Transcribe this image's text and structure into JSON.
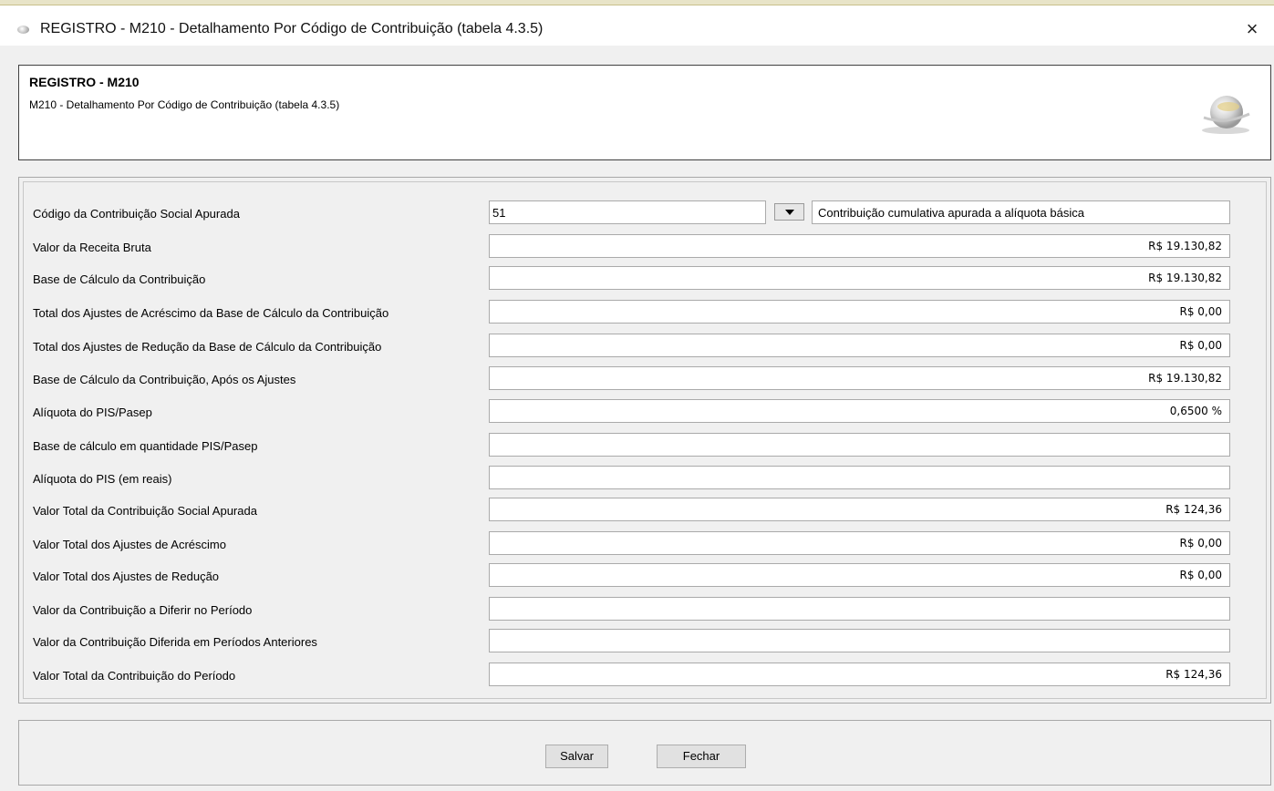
{
  "window": {
    "title": "REGISTRO - M210 - Detalhamento Por Código de Contribuição (tabela 4.3.5)",
    "close_glyph": "×"
  },
  "header": {
    "title": "REGISTRO - M210",
    "subtitle": "M210 - Detalhamento Por Código de Contribuição (tabela 4.3.5)",
    "logo_icon": "sped-globe-logo"
  },
  "form": {
    "codigo": {
      "label": "Código da Contribuição Social Apurada",
      "value": "51",
      "description": "Contribuição cumulativa apurada a alíquota básica"
    },
    "fields": [
      {
        "label": "Valor da Receita Bruta",
        "value": "R$ 19.130,82"
      },
      {
        "label": "Base de Cálculo da Contribuição",
        "value": "R$ 19.130,82"
      },
      {
        "label": "Total dos Ajustes de Acréscimo da Base de Cálculo da Contribuição",
        "value": "R$ 0,00"
      },
      {
        "label": "Total dos Ajustes de Redução da Base de Cálculo da Contribuição",
        "value": "R$ 0,00"
      },
      {
        "label": "Base de Cálculo da Contribuição, Após os Ajustes",
        "value": "R$ 19.130,82"
      },
      {
        "label": "Alíquota do PIS/Pasep",
        "value": "0,6500 %"
      },
      {
        "label": "Base de cálculo em quantidade PIS/Pasep",
        "value": ""
      },
      {
        "label": "Alíquota do PIS (em reais)",
        "value": ""
      },
      {
        "label": "Valor Total da Contribuição Social Apurada",
        "value": "R$ 124,36"
      },
      {
        "label": "Valor Total dos Ajustes de Acréscimo",
        "value": "R$ 0,00"
      },
      {
        "label": "Valor Total dos Ajustes de Redução",
        "value": "R$ 0,00"
      },
      {
        "label": "Valor da Contribuição a Diferir no Período",
        "value": ""
      },
      {
        "label": "Valor da Contribuição Diferida em Períodos Anteriores",
        "value": ""
      },
      {
        "label": "Valor Total da Contribuição do Período",
        "value": "R$ 124,36"
      }
    ]
  },
  "buttons": {
    "save": "Salvar",
    "close": "Fechar"
  }
}
